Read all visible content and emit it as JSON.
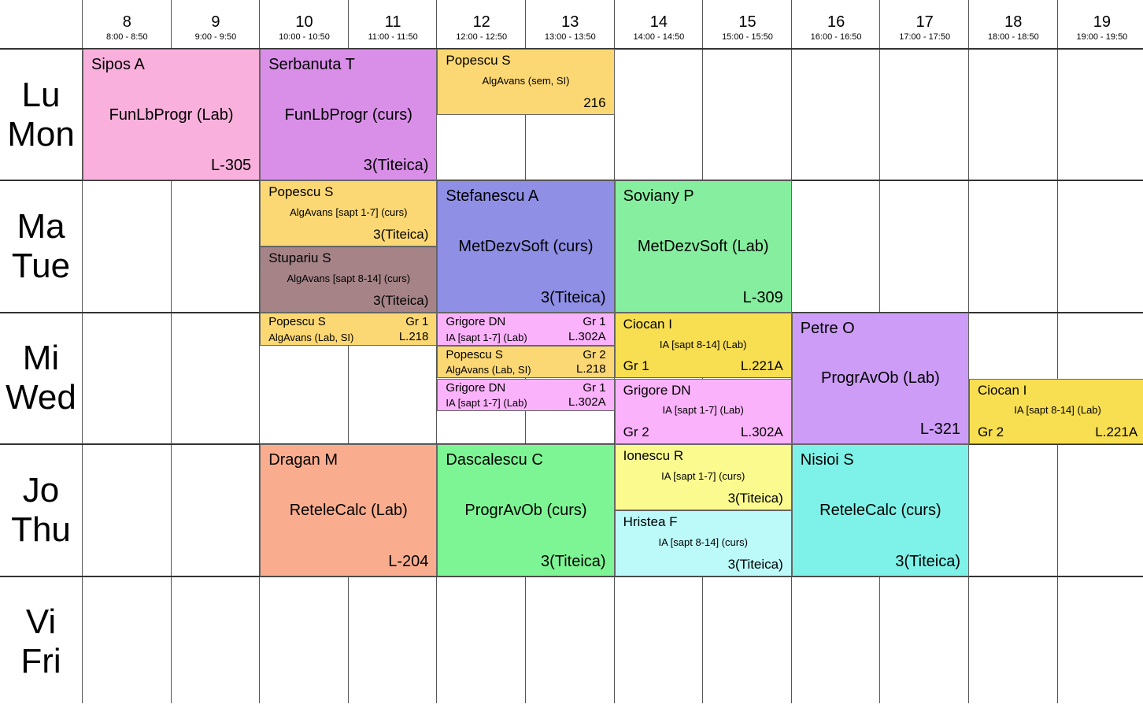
{
  "hours": [
    {
      "num": "8",
      "range": "8:00 - 8:50"
    },
    {
      "num": "9",
      "range": "9:00 - 9:50"
    },
    {
      "num": "10",
      "range": "10:00 - 10:50"
    },
    {
      "num": "11",
      "range": "11:00 - 11:50"
    },
    {
      "num": "12",
      "range": "12:00 - 12:50"
    },
    {
      "num": "13",
      "range": "13:00 - 13:50"
    },
    {
      "num": "14",
      "range": "14:00 - 14:50"
    },
    {
      "num": "15",
      "range": "15:00 - 15:50"
    },
    {
      "num": "16",
      "range": "16:00 - 16:50"
    },
    {
      "num": "17",
      "range": "17:00 - 17:50"
    },
    {
      "num": "18",
      "range": "18:00 - 18:50"
    },
    {
      "num": "19",
      "range": "19:00 - 19:50"
    }
  ],
  "days": [
    {
      "ro": "Lu",
      "en": "Mon"
    },
    {
      "ro": "Ma",
      "en": "Tue"
    },
    {
      "ro": "Mi",
      "en": "Wed"
    },
    {
      "ro": "Jo",
      "en": "Thu"
    },
    {
      "ro": "Vi",
      "en": "Fri"
    }
  ],
  "events": [
    {
      "day": 0,
      "start": 8,
      "end": 10,
      "part": [
        0,
        1
      ],
      "color": "#f9b0dc",
      "teacher": "Sipos A",
      "subject": "FunLbProgr (Lab)",
      "room": "L-305",
      "style": "big"
    },
    {
      "day": 0,
      "start": 10,
      "end": 12,
      "part": [
        0,
        1
      ],
      "color": "#d98fe8",
      "teacher": "Serbanuta T",
      "subject": "FunLbProgr (curs)",
      "room": "3(Titeica)",
      "style": "big"
    },
    {
      "day": 0,
      "start": 12,
      "end": 14,
      "part": [
        0,
        0.5
      ],
      "color": "#fcd874",
      "teacher": "Popescu S",
      "subject": "AlgAvans (sem, SI)",
      "room": "216",
      "style": "sm"
    },
    {
      "day": 1,
      "start": 10,
      "end": 12,
      "part": [
        0,
        0.5
      ],
      "color": "#fcd874",
      "teacher": "Popescu S",
      "subject": "AlgAvans [sapt 1-7] (curs)",
      "room": "3(Titeica)",
      "style": "sm"
    },
    {
      "day": 1,
      "start": 10,
      "end": 12,
      "part": [
        0.5,
        1
      ],
      "color": "#a58387",
      "teacher": "Stupariu S",
      "subject": "AlgAvans [sapt 8-14] (curs)",
      "room": "3(Titeica)",
      "style": "sm"
    },
    {
      "day": 1,
      "start": 12,
      "end": 14,
      "part": [
        0,
        1
      ],
      "color": "#8f8fe6",
      "teacher": "Stefanescu A",
      "subject": "MetDezvSoft (curs)",
      "room": "3(Titeica)",
      "style": "big"
    },
    {
      "day": 1,
      "start": 14,
      "end": 16,
      "part": [
        0,
        1
      ],
      "color": "#86ee9f",
      "teacher": "Soviany P",
      "subject": "MetDezvSoft (Lab)",
      "room": "L-309",
      "style": "big"
    },
    {
      "day": 2,
      "start": 10,
      "end": 12,
      "part": [
        0,
        0.25
      ],
      "color": "#fcd874",
      "teacher": "Popescu S",
      "group": "Gr 1",
      "subject": "AlgAvans (Lab, SI)",
      "room": "L.218",
      "style": "xs"
    },
    {
      "day": 2,
      "start": 12,
      "end": 14,
      "part": [
        0,
        0.25
      ],
      "color": "#fab2fa",
      "teacher": "Grigore DN",
      "group": "Gr 1",
      "subject": "IA [sapt 1-7] (Lab)",
      "room": "L.302A",
      "style": "xs"
    },
    {
      "day": 2,
      "start": 12,
      "end": 14,
      "part": [
        0.25,
        0.5
      ],
      "color": "#fcd874",
      "teacher": "Popescu S",
      "group": "Gr 2",
      "subject": "AlgAvans (Lab, SI)",
      "room": "L.218",
      "style": "xs"
    },
    {
      "day": 2,
      "start": 12,
      "end": 14,
      "part": [
        0.5,
        0.75
      ],
      "color": "#fab2fa",
      "teacher": "Grigore DN",
      "group": "Gr 1",
      "subject": "IA [sapt 1-7] (Lab)",
      "room": "L.302A",
      "style": "xs"
    },
    {
      "day": 2,
      "start": 14,
      "end": 16,
      "part": [
        0,
        0.5
      ],
      "color": "#f8df52",
      "teacher": "Ciocan I",
      "subject": "IA [sapt 8-14] (Lab)",
      "grp": "Gr 1",
      "room": "L.221A",
      "style": "sm"
    },
    {
      "day": 2,
      "start": 14,
      "end": 16,
      "part": [
        0.5,
        1
      ],
      "color": "#fab2fa",
      "teacher": "Grigore DN",
      "subject": "IA [sapt 1-7] (Lab)",
      "grp": "Gr 2",
      "room": "L.302A",
      "style": "sm"
    },
    {
      "day": 2,
      "start": 16,
      "end": 18,
      "part": [
        0,
        1
      ],
      "color": "#cc9cf7",
      "teacher": "Petre O",
      "subject": "ProgrAvOb (Lab)",
      "room": "L-321",
      "style": "big"
    },
    {
      "day": 2,
      "start": 18,
      "end": 20,
      "part": [
        0.5,
        1
      ],
      "color": "#f8df52",
      "teacher": "Ciocan I",
      "subject": "IA [sapt 8-14] (Lab)",
      "grp": "Gr 2",
      "room": "L.221A",
      "style": "sm"
    },
    {
      "day": 3,
      "start": 10,
      "end": 12,
      "part": [
        0,
        1
      ],
      "color": "#f9ad8e",
      "teacher": "Dragan M",
      "subject": "ReteleCalc (Lab)",
      "room": "L-204",
      "style": "big"
    },
    {
      "day": 3,
      "start": 12,
      "end": 14,
      "part": [
        0,
        1
      ],
      "color": "#7df594",
      "teacher": "Dascalescu C",
      "subject": "ProgrAvOb (curs)",
      "room": "3(Titeica)",
      "style": "big"
    },
    {
      "day": 3,
      "start": 14,
      "end": 16,
      "part": [
        0,
        0.5
      ],
      "color": "#fafa8e",
      "teacher": "Ionescu R",
      "subject": "IA [sapt 1-7] (curs)",
      "room": "3(Titeica)",
      "style": "sm"
    },
    {
      "day": 3,
      "start": 14,
      "end": 16,
      "part": [
        0.5,
        1
      ],
      "color": "#bcfafa",
      "teacher": "Hristea F",
      "subject": "IA [sapt 8-14] (curs)",
      "room": "3(Titeica)",
      "style": "sm"
    },
    {
      "day": 3,
      "start": 16,
      "end": 18,
      "part": [
        0,
        1
      ],
      "color": "#7ef2e8",
      "teacher": "Nisioi S",
      "subject": "ReteleCalc (curs)",
      "room": "3(Titeica)",
      "style": "big"
    }
  ]
}
